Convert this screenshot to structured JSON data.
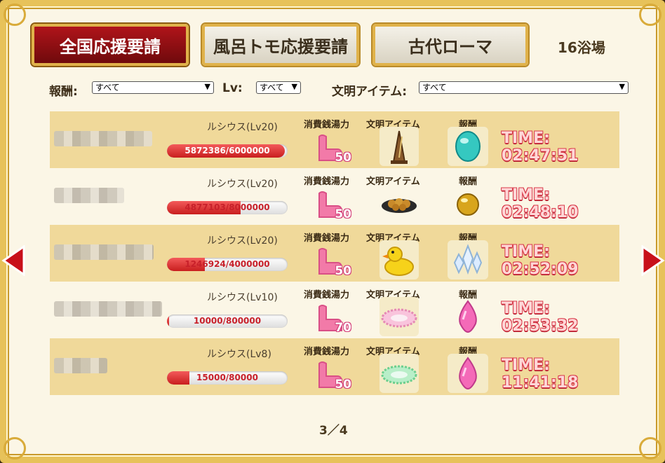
{
  "tabs": [
    {
      "label": "全国応援要請",
      "active": true
    },
    {
      "label": "風呂トモ応援要請",
      "active": false
    },
    {
      "label": "古代ローマ",
      "active": false
    }
  ],
  "bath_count": "16浴場",
  "filters": {
    "reward_label": "報酬:",
    "reward_value": "すべて",
    "lv_label": "Lv:",
    "lv_value": "すべて",
    "civ_label": "文明アイテム:",
    "civ_value": "すべて"
  },
  "column_headers": {
    "cost": "消費銭湯力",
    "civ_item": "文明アイテム",
    "reward": "報酬"
  },
  "rows": [
    {
      "boss": "ルシウス(Lv20)",
      "hp_text": "5872386/6000000",
      "hp_fraction": 0.979,
      "cost": "50",
      "civ_item_icon": "metronome-icon",
      "reward_icon": "teal-gem-icon",
      "time": "TIME: 02:47:51"
    },
    {
      "boss": "ルシウス(Lv20)",
      "hp_text": "4877103/8000000",
      "hp_fraction": 0.61,
      "cost": "50",
      "civ_item_icon": "takoyaki-icon",
      "reward_icon": "gold-orb-icon",
      "time": "TIME: 02:48:10"
    },
    {
      "boss": "ルシウス(Lv20)",
      "hp_text": "1246924/4000000",
      "hp_fraction": 0.312,
      "cost": "50",
      "civ_item_icon": "rubber-duck-icon",
      "reward_icon": "crystal-cluster-icon",
      "time": "TIME: 02:52:09"
    },
    {
      "boss": "ルシウス(Lv10)",
      "hp_text": "10000/800000",
      "hp_fraction": 0.0125,
      "cost": "70",
      "civ_item_icon": "pink-shampoo-hat-icon",
      "reward_icon": "pink-gem-icon",
      "time": "TIME: 02:53:32"
    },
    {
      "boss": "ルシウス(Lv8)",
      "hp_text": "15000/80000",
      "hp_fraction": 0.1875,
      "cost": "50",
      "civ_item_icon": "green-shampoo-hat-icon",
      "reward_icon": "pink-gem-icon",
      "time": "TIME: 11:41:18"
    }
  ],
  "pager": "3／4",
  "colors": {
    "tab_active": "#9b1116",
    "accent_gold": "#e0b24a",
    "timer_outline": "#d83a4a",
    "row_odd": "#f0d99a"
  }
}
